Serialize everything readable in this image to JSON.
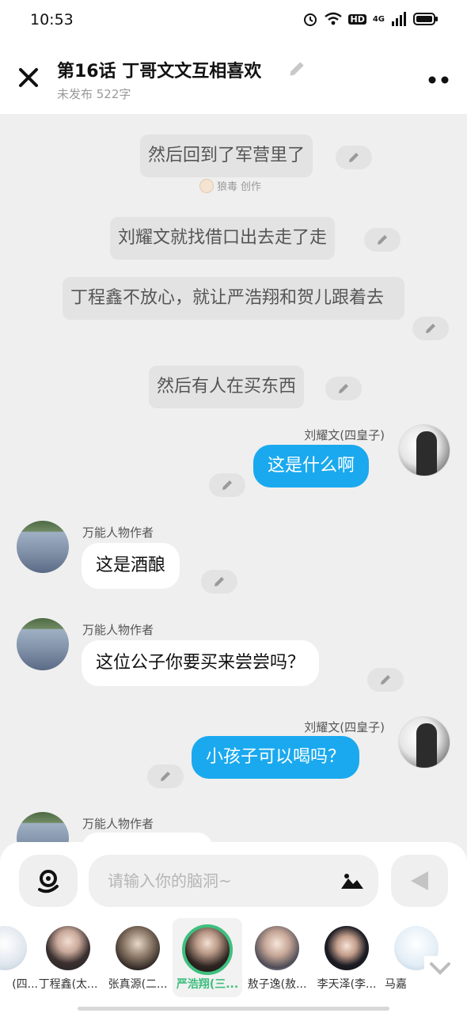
{
  "status_bar": {
    "time": "10:53",
    "network": "4G",
    "hd": "HD"
  },
  "header": {
    "title": "第16话   丁哥文文互相喜欢",
    "subtitle": "未发布 522字"
  },
  "messages": {
    "n1": "然后回到了军营里了",
    "creator_name": "狼毒",
    "creator_suffix": "创作",
    "n2": "刘耀文就找借口出去走了走",
    "n3": "丁程鑫不放心，就让严浩翔和贺儿跟着去",
    "n4": "然后有人在买东西",
    "m1_name": "刘耀文(四皇子)",
    "m1_text": "这是什么啊",
    "m2_name": "万能人物作者",
    "m2_text": "这是酒酿",
    "m3_name": "万能人物作者",
    "m3_text": "这位公子你要买来尝尝吗？",
    "m4_name": "刘耀文(四皇子)",
    "m4_text": "小孩子可以喝吗？",
    "m5_name": "万能人物作者"
  },
  "input": {
    "placeholder": "请输入你的脑洞~"
  },
  "characters": [
    {
      "label": "(四..."
    },
    {
      "label": "丁程鑫(太..."
    },
    {
      "label": "张真源(二..."
    },
    {
      "label": "严浩翔(三..."
    },
    {
      "label": "敖子逸(敖..."
    },
    {
      "label": "李天泽(李..."
    },
    {
      "label": "马嘉"
    }
  ],
  "colors": {
    "accent_blue": "#1aa9ee",
    "selected_green": "#3fbf7f"
  }
}
